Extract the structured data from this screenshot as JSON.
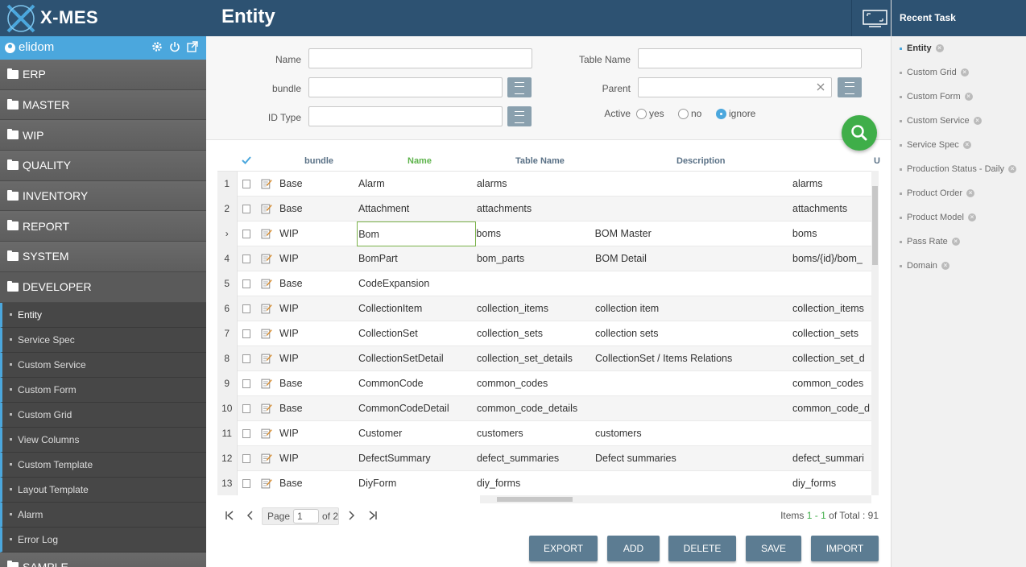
{
  "brand": {
    "name": "X-MES"
  },
  "user": {
    "name": "elidom"
  },
  "header": {
    "title": "Entity"
  },
  "recent": {
    "title": "Recent Task",
    "items": [
      "Entity",
      "Custom Grid",
      "Custom Form",
      "Custom Service",
      "Service Spec",
      "Production Status - Daily",
      "Product Order",
      "Product Model",
      "Pass Rate",
      "Domain"
    ]
  },
  "menu": {
    "items": [
      "ERP",
      "MASTER",
      "WIP",
      "QUALITY",
      "INVENTORY",
      "REPORT",
      "SYSTEM",
      "DEVELOPER"
    ],
    "sub_items": [
      "Entity",
      "Service Spec",
      "Custom Service",
      "Custom Form",
      "Custom Grid",
      "View Columns",
      "Custom Template",
      "Layout Template",
      "Alarm",
      "Error Log"
    ],
    "after": "SAMPLE"
  },
  "search": {
    "name_label": "Name",
    "bundle_label": "bundle",
    "idtype_label": "ID Type",
    "table_name_label": "Table Name",
    "parent_label": "Parent",
    "active_label": "Active",
    "radio_yes": "yes",
    "radio_no": "no",
    "radio_ignore": "ignore",
    "active_selected": "ignore",
    "name_value": "",
    "bundle_value": "",
    "idtype_value": "",
    "table_name_value": "",
    "parent_value": ""
  },
  "grid": {
    "columns": {
      "bundle": "bundle",
      "name": "Name",
      "table": "Table Name",
      "desc": "Description",
      "url": "U"
    },
    "rows": [
      {
        "n": "1",
        "bundle": "Base",
        "name": "Alarm",
        "table": "alarms",
        "desc": "",
        "url": "alarms"
      },
      {
        "n": "2",
        "bundle": "Base",
        "name": "Attachment",
        "table": "attachments",
        "desc": "",
        "url": "attachments"
      },
      {
        "n": "›",
        "bundle": "WIP",
        "name": "Bom",
        "table": "boms",
        "desc": "BOM Master",
        "url": "boms"
      },
      {
        "n": "4",
        "bundle": "WIP",
        "name": "BomPart",
        "table": "bom_parts",
        "desc": "BOM Detail",
        "url": "boms/{id}/bom_"
      },
      {
        "n": "5",
        "bundle": "Base",
        "name": "CodeExpansion",
        "table": "",
        "desc": "",
        "url": ""
      },
      {
        "n": "6",
        "bundle": "WIP",
        "name": "CollectionItem",
        "table": "collection_items",
        "desc": "collection item",
        "url": "collection_items"
      },
      {
        "n": "7",
        "bundle": "WIP",
        "name": "CollectionSet",
        "table": "collection_sets",
        "desc": "collection sets",
        "url": "collection_sets"
      },
      {
        "n": "8",
        "bundle": "WIP",
        "name": "CollectionSetDetail",
        "table": "collection_set_details",
        "desc": "CollectionSet / Items Relations",
        "url": "collection_set_d"
      },
      {
        "n": "9",
        "bundle": "Base",
        "name": "CommonCode",
        "table": "common_codes",
        "desc": "",
        "url": "common_codes"
      },
      {
        "n": "10",
        "bundle": "Base",
        "name": "CommonCodeDetail",
        "table": "common_code_details",
        "desc": "",
        "url": "common_code_d"
      },
      {
        "n": "11",
        "bundle": "WIP",
        "name": "Customer",
        "table": "customers",
        "desc": "customers",
        "url": ""
      },
      {
        "n": "12",
        "bundle": "WIP",
        "name": "DefectSummary",
        "table": "defect_summaries",
        "desc": "Defect summaries",
        "url": "defect_summari"
      },
      {
        "n": "13",
        "bundle": "Base",
        "name": "DiyForm",
        "table": "diy_forms",
        "desc": "",
        "url": "diy_forms"
      }
    ]
  },
  "pager": {
    "page_label": "Page",
    "page_value": "1",
    "of_label": "of 2",
    "items_label": "Items",
    "range_start": "1",
    "range_sep": " - ",
    "range_end": "1",
    "total_label": "of Total : 91"
  },
  "buttons": {
    "export": "EXPORT",
    "add": "ADD",
    "delete": "DELETE",
    "save": "SAVE",
    "import": "IMPORT"
  },
  "colors": {
    "header": "#2d5272",
    "accent": "#4ba7dd",
    "search_fab": "#3fae49",
    "button": "#5c7c92"
  }
}
